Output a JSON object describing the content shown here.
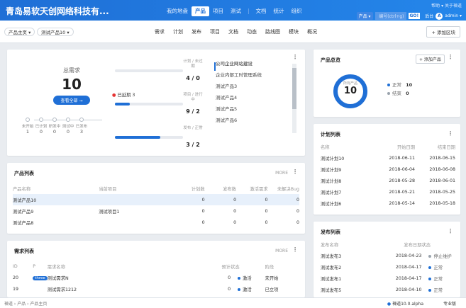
{
  "app": {
    "brand": "青岛易软天创网络科技有...",
    "nav": [
      "我的地盘",
      "产品",
      "项目",
      "测试",
      "文档",
      "统计",
      "组织"
    ],
    "nav_active": 1,
    "top_links": "帮助 ▾   关于禅道",
    "product_select": "产品 ▾",
    "search_placeholder": "编号(ctrl+g)",
    "go": "GO!",
    "backend": "后台",
    "user": "admin ▾",
    "avatar": "A"
  },
  "subbar": {
    "crumb_home": "产品主页 ▾",
    "crumb_product": "测试产品10 ▾",
    "nav": [
      "需求",
      "计划",
      "发布",
      "项目",
      "文档",
      "动态",
      "路线图",
      "模块",
      "概况"
    ],
    "add_block": "+ 添加区块"
  },
  "story_stats": {
    "label": "总需求",
    "total": "10",
    "view_all": "查看全部 →",
    "overdue": "已延期 3",
    "stages": [
      {
        "label": "未开始",
        "value": "1"
      },
      {
        "label": "已计划",
        "value": "0"
      },
      {
        "label": "研发中",
        "value": "0"
      },
      {
        "label": "测试中",
        "value": "0"
      },
      {
        "label": "已发布",
        "value": "3"
      }
    ],
    "rows": [
      {
        "label": "计划 / 未过期",
        "value": "4 / 0",
        "fill": 0
      },
      {
        "label": "项目 / 进行中",
        "value": "9 / 2",
        "fill": 0.22
      },
      {
        "label": "发布 / 正常",
        "value": "3 / 2",
        "fill": 0.67
      }
    ],
    "projects": [
      "公司企业网站建设",
      "企业内部工时管理系统",
      "测试产品3",
      "测试产品4",
      "测试产品5",
      "测试产品6"
    ]
  },
  "product_overview": {
    "title": "产品总览",
    "add": "+ 添加产品",
    "ring_label": "所有产品",
    "ring_value": "10",
    "normal_label": "正常",
    "normal_value": "10",
    "closed_label": "结束",
    "closed_value": "0",
    "ring_fraction": 1
  },
  "plans": {
    "title": "计划列表",
    "headers": [
      "名称",
      "开始日期",
      "结束日期"
    ],
    "rows": [
      [
        "测试计划10",
        "2018-06-11",
        "2018-06-15"
      ],
      [
        "测试计划9",
        "2018-06-04",
        "2018-06-08"
      ],
      [
        "测试计划8",
        "2018-05-28",
        "2018-06-01"
      ],
      [
        "测试计划7",
        "2018-05-21",
        "2018-05-25"
      ],
      [
        "测试计划6",
        "2018-05-14",
        "2018-05-18"
      ]
    ]
  },
  "products": {
    "title": "产品列表",
    "more": "MORE",
    "headers": [
      "产品名称",
      "当前项目",
      "计划数",
      "发布数",
      "激活需求",
      "未解决Bug"
    ],
    "rows": [
      [
        "测试产品10",
        "",
        "0",
        "0",
        "0",
        "0"
      ],
      [
        "测试产品9",
        "测试项目1",
        "0",
        "0",
        "0",
        "0"
      ],
      [
        "测试产品8",
        "",
        "0",
        "0",
        "0",
        "0"
      ]
    ]
  },
  "stories": {
    "title": "需求列表",
    "more": "MORE",
    "headers": [
      "ID",
      "P",
      "需求名称",
      "预计",
      "状态",
      "阶段"
    ],
    "rows": [
      [
        "20",
        "three",
        "测试需求N",
        "0",
        "激活",
        "未开始"
      ],
      [
        "19",
        "",
        "测试需求1212",
        "0",
        "激活",
        "已立项"
      ]
    ]
  },
  "releases": {
    "title": "发布列表",
    "headers": [
      "发布名称",
      "发布日期",
      "状态"
    ],
    "rows": [
      [
        "测试发布3",
        "2018-04-23",
        "停止维护"
      ],
      [
        "测试发布2",
        "2018-04-17",
        "正常"
      ],
      [
        "测试发布1",
        "2018-04-17",
        "正常"
      ],
      [
        "测试发布5",
        "2018-04-10",
        "正常"
      ]
    ]
  },
  "footer": {
    "breadcrumb": "禅道 › 产品 › 产品主页",
    "version": "禅道10.0.alpha",
    "edition": "专业版"
  },
  "colors": {
    "primary": "#1f6fd6",
    "danger": "#e53333",
    "gray": "#9aa3ad"
  }
}
